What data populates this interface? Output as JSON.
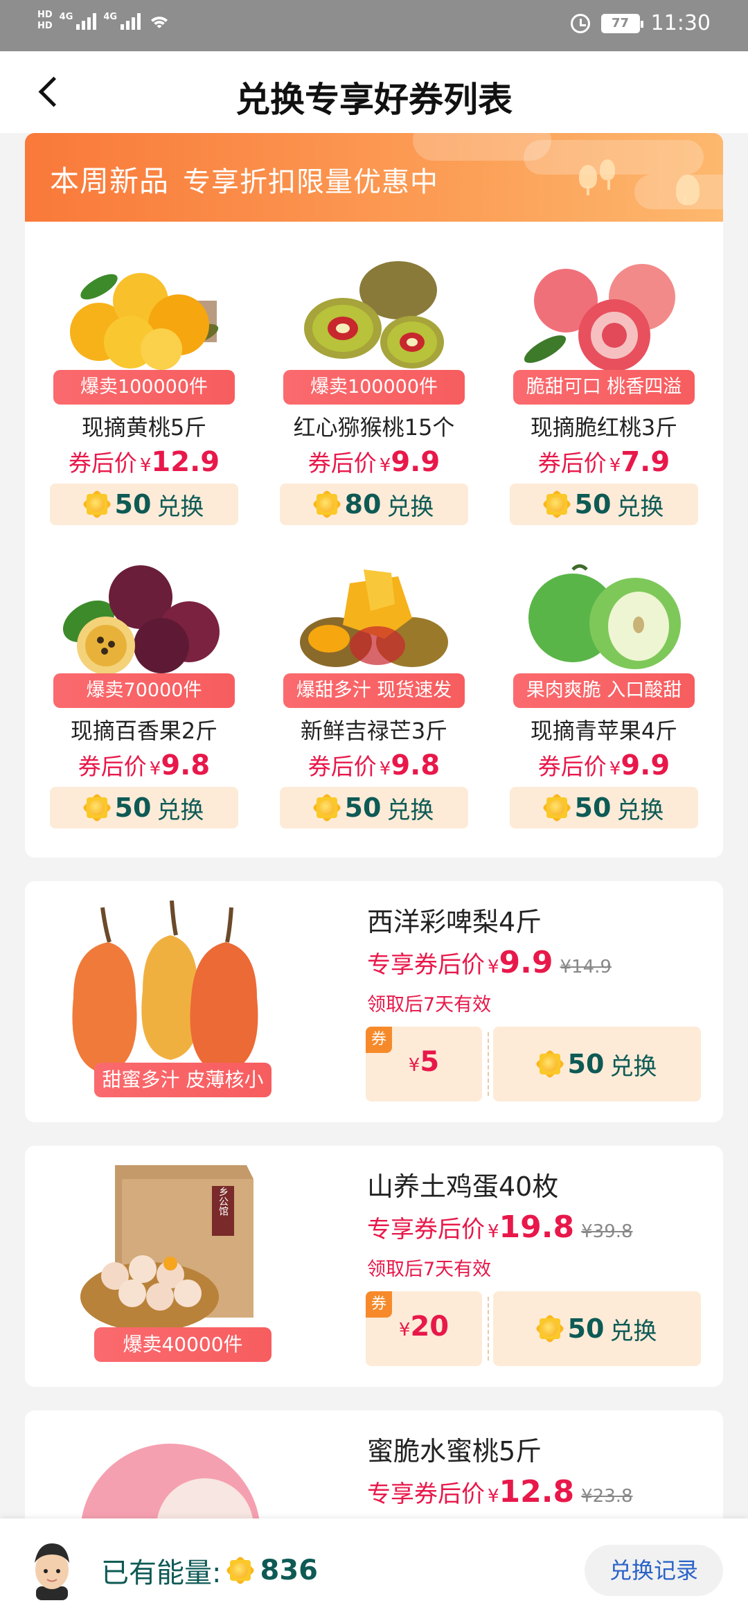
{
  "status_bar": {
    "network_labels": [
      "HD",
      "HD"
    ],
    "signal_1": "4G",
    "signal_2": "4G",
    "battery": "77",
    "time": "11:30"
  },
  "header": {
    "title": "兑换专享好券列表"
  },
  "banner": {
    "title": "本周新品",
    "subtitle": "专享折扣限量优惠中"
  },
  "price_label": "券后价",
  "exchange_label": "兑换",
  "currency": "¥",
  "grid_items": [
    {
      "tag": "爆卖100000件",
      "name": "现摘黄桃5斤",
      "price": "12.9",
      "energy": "50"
    },
    {
      "tag": "爆卖100000件",
      "name": "红心猕猴桃15个",
      "price": "9.9",
      "energy": "80"
    },
    {
      "tag": "脆甜可口 桃香四溢",
      "name": "现摘脆红桃3斤",
      "price": "7.9",
      "energy": "50"
    },
    {
      "tag": "爆卖70000件",
      "name": "现摘百香果2斤",
      "price": "9.8",
      "energy": "50"
    },
    {
      "tag": "爆甜多汁 现货速发",
      "name": "新鲜吉禄芒3斤",
      "price": "9.8",
      "energy": "50"
    },
    {
      "tag": "果肉爽脆 入口酸甜",
      "name": "现摘青苹果4斤",
      "price": "9.9",
      "energy": "50"
    }
  ],
  "list_price_label": "专享券后价",
  "coupon_badge": "券",
  "list_items": [
    {
      "tag": "甜蜜多汁 皮薄核小",
      "name": "西洋彩啤梨4斤",
      "price": "9.9",
      "old_price": "¥14.9",
      "validity": "领取后7天有效",
      "coupon": "5",
      "energy": "50"
    },
    {
      "tag": "爆卖40000件",
      "name": "山养土鸡蛋40枚",
      "price": "19.8",
      "old_price": "¥39.8",
      "validity": "领取后7天有效",
      "coupon": "20",
      "energy": "50"
    },
    {
      "name": "蜜脆水蜜桃5斤",
      "price": "12.8",
      "old_price": "¥23.8"
    }
  ],
  "box_label": "乡公馆",
  "bottom_bar": {
    "energy_label": "已有能量:",
    "energy_value": "836",
    "records_button": "兑换记录"
  }
}
